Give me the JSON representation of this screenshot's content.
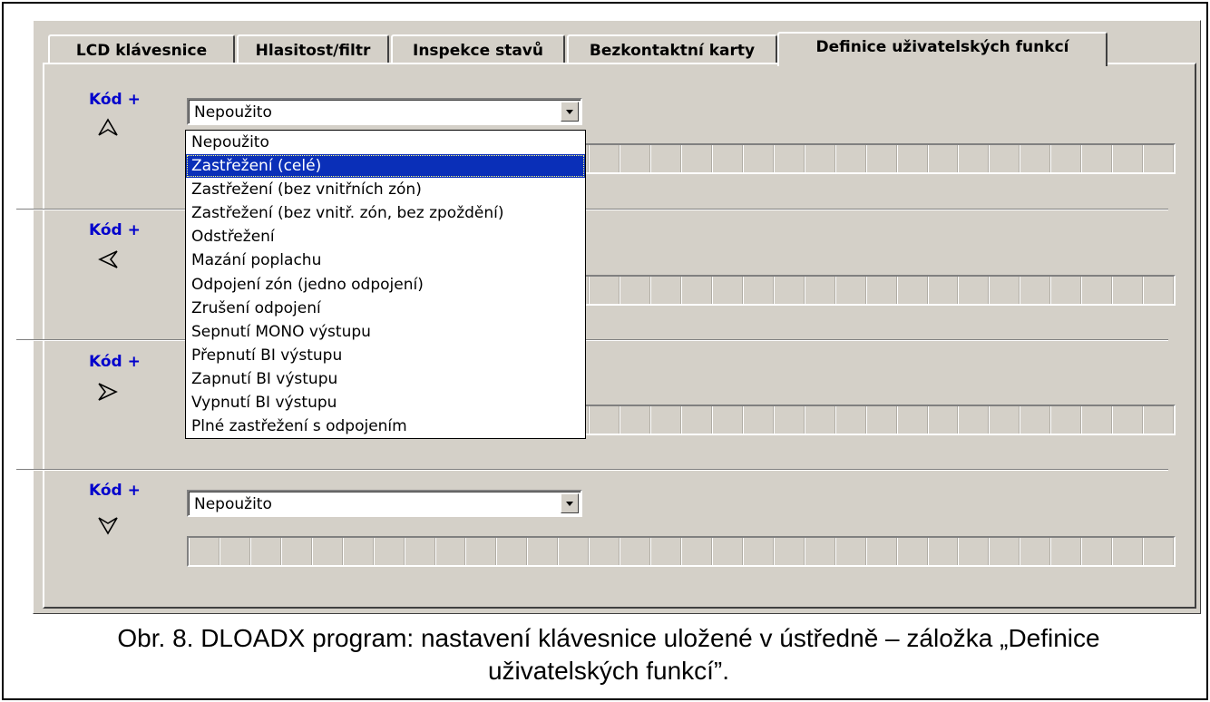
{
  "tabs": [
    {
      "label": "LCD klávesnice"
    },
    {
      "label": "Hlasitost/filtr"
    },
    {
      "label": "Inspekce stavů"
    },
    {
      "label": "Bezkontaktní karty"
    },
    {
      "label": "Definice uživatelských funkcí"
    }
  ],
  "rows": [
    {
      "label": "Kód +",
      "icon": "arrow-up-icon",
      "value": "Nepoužito"
    },
    {
      "label": "Kód +",
      "icon": "arrow-left-icon",
      "value": ""
    },
    {
      "label": "Kód +",
      "icon": "arrow-right-icon",
      "value": ""
    },
    {
      "label": "Kód +",
      "icon": "arrow-down-icon",
      "value": "Nepoužito"
    }
  ],
  "dropdown": {
    "options": [
      "Nepoužito",
      "Zastřežení (celé)",
      "Zastřežení (bez vnitřních zón)",
      "Zastřežení (bez vnitř. zón, bez zpoždění)",
      "Odstřežení",
      "Mazání poplachu",
      "Odpojení zón (jedno odpojení)",
      "Zrušení odpojení",
      "Sepnutí MONO výstupu",
      "Přepnutí BI výstupu",
      "Zapnutí BI výstupu",
      "Vypnutí BI výstupu",
      "Plné zastřežení s odpojením"
    ],
    "selected_index": 1
  },
  "caption": {
    "line1": "Obr. 8. DLOADX program: nastavení klávesnice uložené v ústředně – záložka „Definice",
    "line2": "uživatelských funkcí”."
  },
  "colors": {
    "label_blue": "#0000cc",
    "selection": "#0a2fb8",
    "window_bg": "#d4d0c8"
  }
}
